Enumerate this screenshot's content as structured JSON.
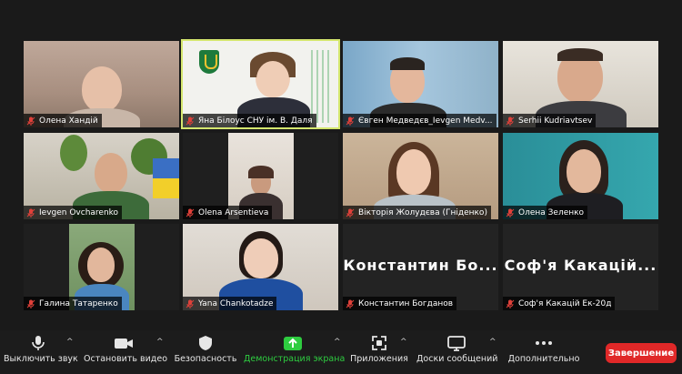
{
  "participants": [
    {
      "name": "Олена Хандій"
    },
    {
      "name": "Яна Білоус СНУ ім. В. Даля"
    },
    {
      "name": "Євген Медведєв_Ievgen Medv..."
    },
    {
      "name": "Serhii Kudriavtsev"
    },
    {
      "name": "Ievgen Ovcharenko"
    },
    {
      "name": "Olena Arsentieva"
    },
    {
      "name": "Вікторія Жолудєва (Гніденко)"
    },
    {
      "name": "Олена Зеленко"
    },
    {
      "name": "Галина Татаренко"
    },
    {
      "name": "Yana Chankotadze"
    },
    {
      "name": "Константин Богданов",
      "display": "Константин  Бо..."
    },
    {
      "name": "Соф'я Какацій Ек-20д",
      "display": "Соф'я  Какацій..."
    }
  ],
  "toolbar": {
    "mute_label": "Выключить звук",
    "video_label": "Остановить видео",
    "security_label": "Безопасность",
    "share_label": "Демонстрация экрана",
    "apps_label": "Приложения",
    "boards_label": "Доски сообщений",
    "more_label": "Дополнительно",
    "end_label": "Завершение"
  },
  "colors": {
    "share": "#2ecc40",
    "end": "#e02828",
    "active_border": "#d4e66e",
    "mic_muted": "#e0413a"
  }
}
